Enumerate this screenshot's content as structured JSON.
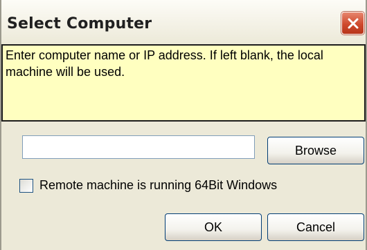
{
  "window": {
    "title": "Select Computer",
    "close_icon": "close-icon"
  },
  "info": {
    "text": "Enter computer name or IP address. If left blank, the local machine will be used."
  },
  "computer_input": {
    "value": "",
    "placeholder": ""
  },
  "buttons": {
    "browse": "Browse",
    "ok": "OK",
    "cancel": "Cancel"
  },
  "checkbox": {
    "label": "Remote machine is running 64Bit Windows",
    "checked": false
  },
  "colors": {
    "dialog_background": "#ece9d8",
    "info_background": "#ffffc0",
    "close_button": "#cf4a2e",
    "button_border": "#003c74"
  }
}
